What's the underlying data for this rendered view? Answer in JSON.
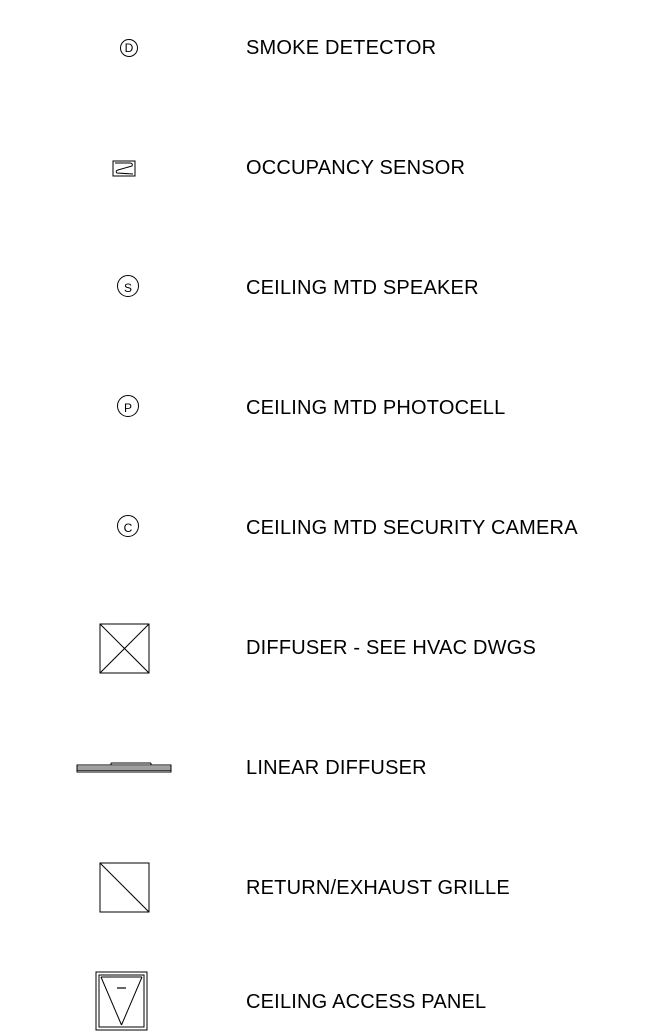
{
  "legend": {
    "items": [
      {
        "symbol": "smoke-detector-symbol",
        "symbol_letter": "D",
        "label": "SMOKE DETECTOR"
      },
      {
        "symbol": "occupancy-sensor-symbol",
        "label": "OCCUPANCY SENSOR"
      },
      {
        "symbol": "speaker-symbol",
        "symbol_letter": "S",
        "label": "CEILING MTD SPEAKER"
      },
      {
        "symbol": "photocell-symbol",
        "symbol_letter": "P",
        "label": "CEILING MTD PHOTOCELL"
      },
      {
        "symbol": "security-camera-symbol",
        "symbol_letter": "C",
        "label": "CEILING MTD SECURITY CAMERA"
      },
      {
        "symbol": "diffuser-symbol",
        "label": "DIFFUSER - SEE HVAC DWGS"
      },
      {
        "symbol": "linear-diffuser-symbol",
        "label": "LINEAR DIFFUSER"
      },
      {
        "symbol": "return-grille-symbol",
        "label": "RETURN/EXHAUST GRILLE"
      },
      {
        "symbol": "access-panel-symbol",
        "label": "CEILING ACCESS PANEL"
      }
    ]
  }
}
